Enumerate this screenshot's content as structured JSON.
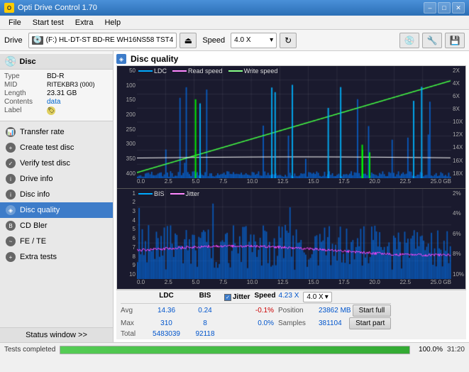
{
  "titleBar": {
    "title": "Opti Drive Control 1.70",
    "icon": "O",
    "minimize": "–",
    "maximize": "□",
    "close": "✕"
  },
  "menuBar": {
    "items": [
      "File",
      "Start test",
      "Extra",
      "Help"
    ]
  },
  "toolbar": {
    "driveLabel": "Drive",
    "driveValue": "(F:)  HL-DT-ST BD-RE  WH16NS58 TST4",
    "speedLabel": "Speed",
    "speedValue": "4.0 X"
  },
  "leftPanel": {
    "discHeader": "Disc",
    "discFields": [
      {
        "key": "Type",
        "val": "BD-R",
        "blue": false
      },
      {
        "key": "MID",
        "val": "RITEKBR3 (000)",
        "blue": false
      },
      {
        "key": "Length",
        "val": "23.31 GB",
        "blue": false
      },
      {
        "key": "Contents",
        "val": "data",
        "blue": true
      },
      {
        "key": "Label",
        "val": "",
        "blue": false
      }
    ],
    "navItems": [
      {
        "id": "transfer-rate",
        "label": "Transfer rate",
        "active": false
      },
      {
        "id": "create-test-disc",
        "label": "Create test disc",
        "active": false
      },
      {
        "id": "verify-test-disc",
        "label": "Verify test disc",
        "active": false
      },
      {
        "id": "drive-info",
        "label": "Drive info",
        "active": false
      },
      {
        "id": "disc-info",
        "label": "Disc info",
        "active": false
      },
      {
        "id": "disc-quality",
        "label": "Disc quality",
        "active": true
      },
      {
        "id": "cd-bler",
        "label": "CD Bler",
        "active": false
      },
      {
        "id": "fe-te",
        "label": "FE / TE",
        "active": false
      },
      {
        "id": "extra-tests",
        "label": "Extra tests",
        "active": false
      }
    ],
    "statusWindow": "Status window >>"
  },
  "chartPanel": {
    "title": "Disc quality",
    "topChart": {
      "legend": [
        {
          "label": "LDC",
          "color": "#00aaff"
        },
        {
          "label": "Read speed",
          "color": "#ff44ff"
        },
        {
          "label": "Write speed",
          "color": "#44ff44"
        }
      ],
      "yLabels": [
        "50",
        "100",
        "150",
        "200",
        "250",
        "300",
        "350",
        "400"
      ],
      "yLabelsRight": [
        "2X",
        "4X",
        "6X",
        "8X",
        "10X",
        "12X",
        "14X",
        "16X",
        "18X"
      ],
      "xLabels": [
        "0.0",
        "2.5",
        "5.0",
        "7.5",
        "10.0",
        "12.5",
        "15.0",
        "17.5",
        "20.0",
        "22.5",
        "25.0 GB"
      ]
    },
    "bottomChart": {
      "legend": [
        {
          "label": "BIS",
          "color": "#00aaff"
        },
        {
          "label": "Jitter",
          "color": "#ff44ff"
        }
      ],
      "yLabels": [
        "1",
        "2",
        "3",
        "4",
        "5",
        "6",
        "7",
        "8",
        "9",
        "10"
      ],
      "yLabelsRight": [
        "2%",
        "4%",
        "6%",
        "8%",
        "10%"
      ],
      "xLabels": [
        "0.0",
        "2.5",
        "5.0",
        "7.5",
        "10.0",
        "12.5",
        "15.0",
        "17.5",
        "20.0",
        "22.5",
        "25.0 GB"
      ]
    }
  },
  "statsBar": {
    "columns": [
      {
        "label": "LDC",
        "avg": "14.36",
        "max": "310",
        "total": "5483039"
      },
      {
        "label": "BIS",
        "avg": "0.24",
        "max": "8",
        "total": "92118"
      },
      {
        "label": "Jitter",
        "avg": "-0.1%",
        "max": "0.0%",
        "total": ""
      }
    ],
    "rowLabels": [
      "Avg",
      "Max",
      "Total"
    ],
    "jitterCheck": true,
    "speed": {
      "label": "Speed",
      "val": "4.23 X",
      "dropVal": "4.0 X"
    },
    "position": {
      "label": "Position",
      "val": "23862 MB"
    },
    "samples": {
      "label": "Samples",
      "val": "381104"
    },
    "startFull": "Start full",
    "startPart": "Start part"
  },
  "statusBar": {
    "text": "Tests completed",
    "progress": 100,
    "progressText": "100.0%",
    "time": "31:20"
  }
}
